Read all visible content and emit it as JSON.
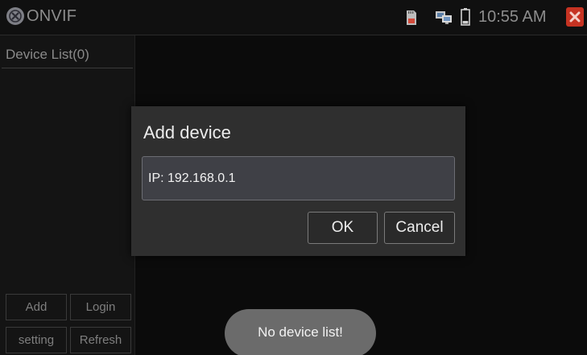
{
  "app": {
    "title": "ONVIF",
    "logo_icon": "onvif-logo-icon"
  },
  "status_bar": {
    "time": "10:55 AM",
    "icons": [
      "sd-card-icon",
      "network-icon",
      "battery-icon",
      "close-icon"
    ],
    "close_color": "#c63322"
  },
  "sidebar": {
    "title": "Device List(0)",
    "buttons": {
      "add": "Add",
      "login": "Login",
      "setting": "setting",
      "refresh": "Refresh"
    }
  },
  "dialog": {
    "title": "Add device",
    "ip_value": "IP: 192.168.0.1",
    "ok_label": "OK",
    "cancel_label": "Cancel"
  },
  "toast": {
    "message": "No device list!"
  }
}
